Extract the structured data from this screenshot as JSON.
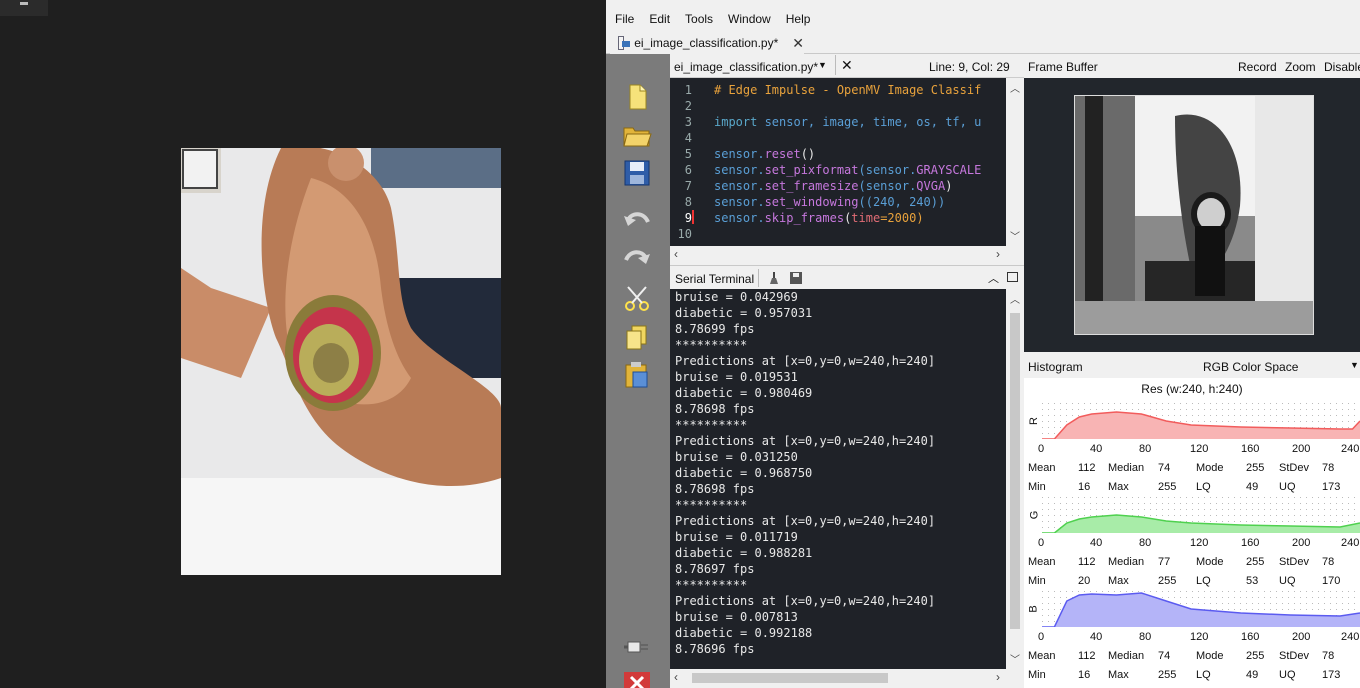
{
  "menu": {
    "file": "File",
    "edit": "Edit",
    "tools": "Tools",
    "window": "Window",
    "help": "Help"
  },
  "file_tab": {
    "name": "ei_image_classification.py*"
  },
  "editor": {
    "file_select": "ei_image_classification.py*",
    "position": "Line: 9, Col: 29",
    "lines": [
      {
        "n": "1",
        "segs": [
          {
            "t": "# Edge Impulse - OpenMV Image Classif",
            "c": "#e8a23c"
          }
        ]
      },
      {
        "n": "2",
        "segs": []
      },
      {
        "n": "3",
        "segs": [
          {
            "t": "import",
            "c": "#59a7c9"
          },
          {
            "t": " sensor, image, time, os, tf, u",
            "c": "#5a9fd6"
          }
        ]
      },
      {
        "n": "4",
        "segs": []
      },
      {
        "n": "5",
        "segs": [
          {
            "t": "sensor.",
            "c": "#5a9fd6"
          },
          {
            "t": "reset",
            "c": "#c678dd"
          },
          {
            "t": "()",
            "c": "#e8e8e8"
          }
        ]
      },
      {
        "n": "6",
        "segs": [
          {
            "t": "sensor.",
            "c": "#5a9fd6"
          },
          {
            "t": "set_pixformat",
            "c": "#c678dd"
          },
          {
            "t": "(sensor.",
            "c": "#5a9fd6"
          },
          {
            "t": "GRAYSCALE",
            "c": "#c678dd"
          }
        ]
      },
      {
        "n": "7",
        "segs": [
          {
            "t": "sensor.",
            "c": "#5a9fd6"
          },
          {
            "t": "set_framesize",
            "c": "#c678dd"
          },
          {
            "t": "(sensor.",
            "c": "#5a9fd6"
          },
          {
            "t": "QVGA",
            "c": "#c678dd"
          },
          {
            "t": ")",
            "c": "#e8e8e8"
          }
        ]
      },
      {
        "n": "8",
        "segs": [
          {
            "t": "sensor.",
            "c": "#5a9fd6"
          },
          {
            "t": "set_windowing",
            "c": "#c678dd"
          },
          {
            "t": "((240, 240))",
            "c": "#5a9fd6"
          }
        ]
      },
      {
        "n": "9",
        "segs": [
          {
            "t": "sensor.",
            "c": "#5a9fd6"
          },
          {
            "t": "skip_frames",
            "c": "#c678dd"
          },
          {
            "t": "(",
            "c": "#e8e8e8"
          },
          {
            "t": "time",
            "c": "#e06c75"
          },
          {
            "t": "=2000)",
            "c": "#e8a23c"
          }
        ]
      },
      {
        "n": "10",
        "segs": []
      }
    ]
  },
  "terminal": {
    "title": "Serial Terminal",
    "lines": [
      "bruise = 0.042969",
      "diabetic = 0.957031",
      "8.78699 fps",
      "**********",
      "Predictions at [x=0,y=0,w=240,h=240]",
      "bruise = 0.019531",
      "diabetic = 0.980469",
      "8.78698 fps",
      "**********",
      "Predictions at [x=0,y=0,w=240,h=240]",
      "bruise = 0.031250",
      "diabetic = 0.968750",
      "8.78698 fps",
      "**********",
      "Predictions at [x=0,y=0,w=240,h=240]",
      "bruise = 0.011719",
      "diabetic = 0.988281",
      "8.78697 fps",
      "**********",
      "Predictions at [x=0,y=0,w=240,h=240]",
      "bruise = 0.007813",
      "diabetic = 0.992188",
      "8.78696 fps"
    ]
  },
  "frame_buffer": {
    "title": "Frame Buffer",
    "record": "Record",
    "zoom": "Zoom",
    "disable": "Disable"
  },
  "histogram": {
    "title": "Histogram",
    "color_space": "RGB Color Space",
    "resolution": "Res (w:240, h:240)",
    "axis": [
      "0",
      "40",
      "80",
      "120",
      "160",
      "200",
      "240"
    ],
    "labels": {
      "mean": "Mean",
      "median": "Median",
      "mode": "Mode",
      "stdev": "StDev",
      "min": "Min",
      "max": "Max",
      "lq": "LQ",
      "uq": "UQ"
    },
    "channels": [
      {
        "name": "R",
        "color": "#f25c5c",
        "fill": "#f8b4b4",
        "mean": "112",
        "median": "74",
        "mode": "255",
        "stdev": "78",
        "min": "16",
        "max": "255",
        "lq": "49",
        "uq": "173"
      },
      {
        "name": "G",
        "color": "#4fd14f",
        "fill": "#a8eca8",
        "mean": "112",
        "median": "77",
        "mode": "255",
        "stdev": "78",
        "min": "20",
        "max": "255",
        "lq": "53",
        "uq": "170"
      },
      {
        "name": "B",
        "color": "#5b5bf0",
        "fill": "#b4b4f8",
        "mean": "112",
        "median": "74",
        "mode": "255",
        "stdev": "78",
        "min": "16",
        "max": "255",
        "lq": "49",
        "uq": "173"
      }
    ]
  },
  "icons": {
    "new": "new-file-icon",
    "open": "open-folder-icon",
    "save": "save-icon",
    "undo": "undo-icon",
    "redo": "redo-icon",
    "cut": "cut-icon",
    "copy": "copy-icon",
    "paste": "paste-icon",
    "connect": "connect-plug-icon",
    "stop": "stop-icon"
  },
  "colors": {
    "editor_bg": "#1f2228",
    "toolbar_bg": "#7b7b7b",
    "panel_bg": "#f0f0f0"
  }
}
